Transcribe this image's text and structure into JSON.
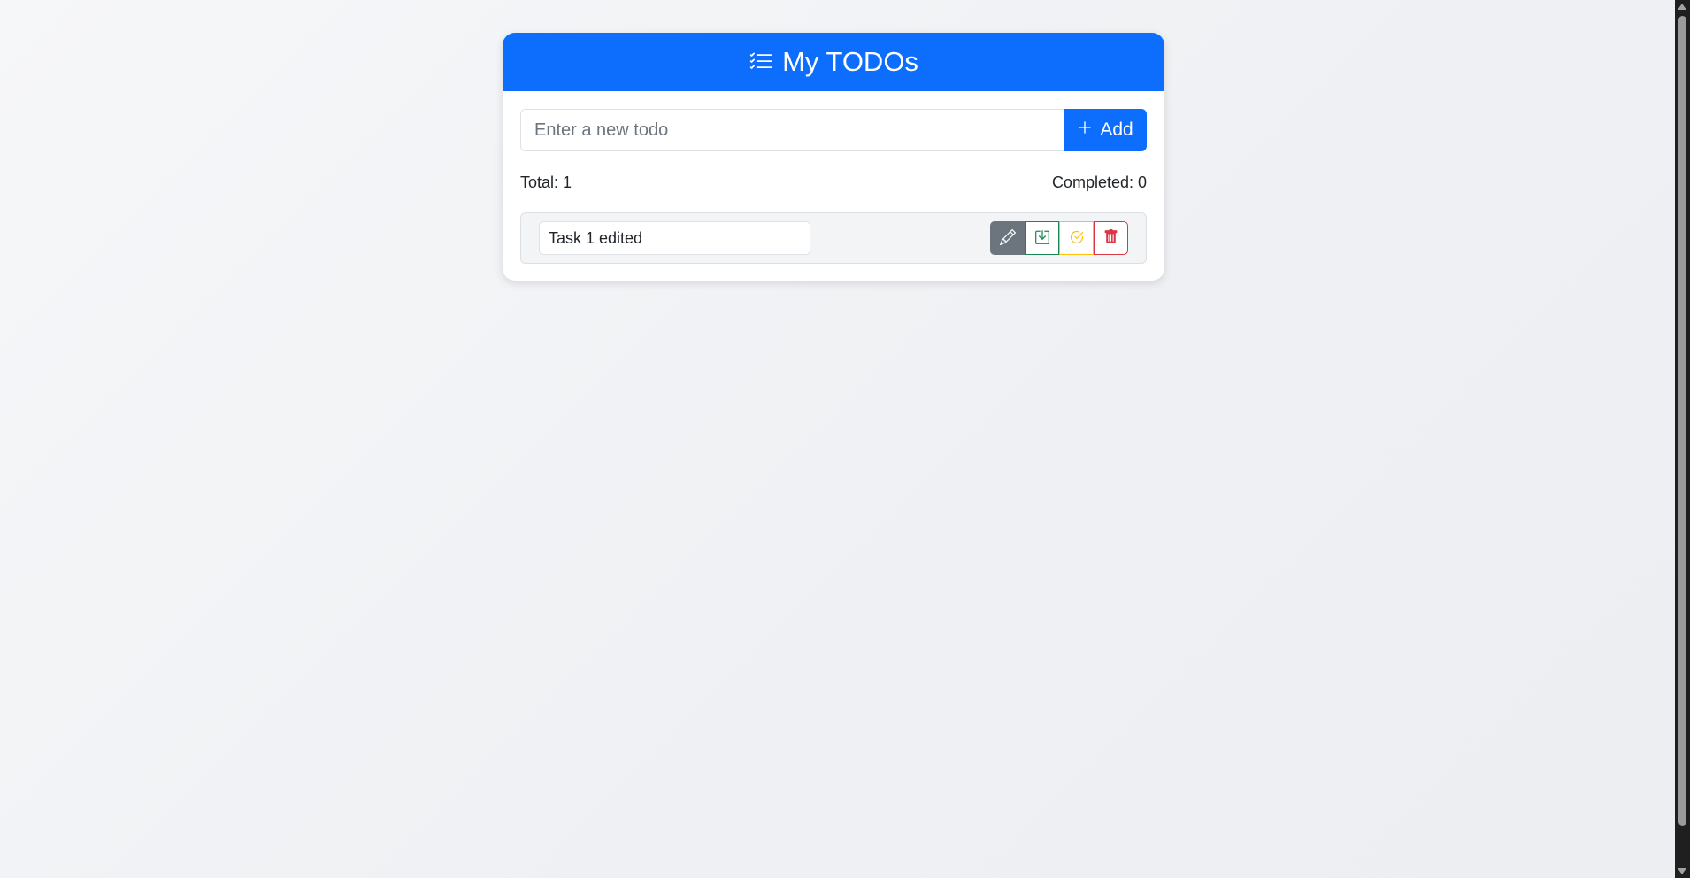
{
  "header": {
    "title": "My TODOs",
    "icon": "list-check-icon"
  },
  "new_todo": {
    "placeholder": "Enter a new todo",
    "value": "",
    "add_label": "Add",
    "add_icon": "plus-icon"
  },
  "stats": {
    "total": "Total: 1",
    "completed": "Completed: 0"
  },
  "todos": [
    {
      "text": "Task 1 edited",
      "actions": [
        "pencil-icon",
        "save-download-icon",
        "check-circle-icon",
        "trash-icon"
      ]
    }
  ],
  "colors": {
    "primary": "#0d6efd",
    "secondary": "#6c757d",
    "success": "#198754",
    "warning": "#ffc107",
    "danger": "#dc3545"
  }
}
